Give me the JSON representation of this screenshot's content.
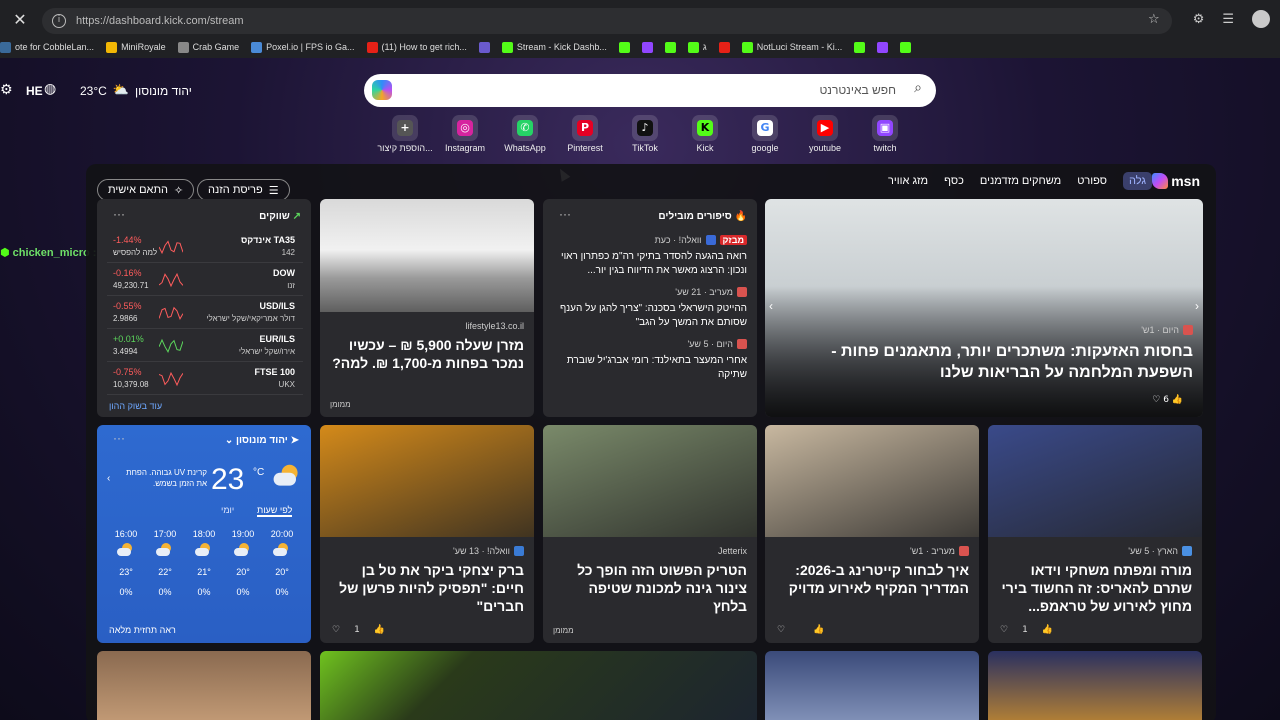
{
  "browser": {
    "url": "https://dashboard.kick.com/stream",
    "bookmarks": [
      {
        "label": "ote for CobbleLan...",
        "color": "#3a6a9a"
      },
      {
        "label": "MiniRoyale",
        "color": "#f2b705"
      },
      {
        "label": "Crab Game",
        "color": "#888"
      },
      {
        "label": "Poxel.io | FPS io Ga...",
        "color": "#4a8ad6"
      },
      {
        "label": "(11) How to get rich...",
        "color": "#e62117"
      },
      {
        "label": "",
        "color": "#6a5acd"
      },
      {
        "label": "Stream - Kick Dashb...",
        "color": "#53fc18"
      },
      {
        "label": "",
        "color": "#53fc18"
      },
      {
        "label": "",
        "color": "#9146ff"
      },
      {
        "label": "",
        "color": "#53fc18"
      },
      {
        "label": "ג",
        "color": "#53fc18"
      },
      {
        "label": "",
        "color": "#e62117"
      },
      {
        "label": "NotLuci Stream - Ki...",
        "color": "#53fc18"
      },
      {
        "label": "",
        "color": "#53fc18"
      },
      {
        "label": "",
        "color": "#9146ff"
      },
      {
        "label": "",
        "color": "#53fc18"
      }
    ]
  },
  "toolbar": {
    "lang": "HE",
    "temp": "23°C",
    "city": "יהוד מונוסון"
  },
  "search": {
    "placeholder": "חפש באינטרנט"
  },
  "quick_links": [
    {
      "label": "הוספת קיצור...",
      "icon": "+",
      "color": "#555"
    },
    {
      "label": "Instagram",
      "icon": "◎",
      "color": "#d6249f"
    },
    {
      "label": "WhatsApp",
      "icon": "✆",
      "color": "#25d366"
    },
    {
      "label": "Pinterest",
      "icon": "P",
      "color": "#e60023"
    },
    {
      "label": "TikTok",
      "icon": "♪",
      "color": "#111"
    },
    {
      "label": "Kick",
      "icon": "K",
      "color": "#53fc18"
    },
    {
      "label": "google",
      "icon": "G",
      "color": "#fff"
    },
    {
      "label": "youtube",
      "icon": "▶",
      "color": "#ff0000"
    },
    {
      "label": "twitch",
      "icon": "▣",
      "color": "#9146ff"
    }
  ],
  "feed_nav": {
    "brand": "msn",
    "items": [
      "גלה",
      "ספורט",
      "משחקים מזדמנים",
      "כסף",
      "מזג אוויר"
    ],
    "active": "גלה",
    "personalize": "התאם אישית",
    "layout": "פריסת הזנה"
  },
  "hero": {
    "source": "היום · 1ש'",
    "title": "בחסות האזעקות: משתכרים יותר, מתאמנים פחות - השפעת המלחמה על הבריאות שלנו",
    "likes": "6"
  },
  "top_stories": {
    "header": "סיפורים מובילים",
    "items": [
      {
        "source": "וואלה! · כעת",
        "badge": "מבזק",
        "text": "רואה בהגעה להסדר בתיקי רה\"מ כפתרון ראוי ונכון: הרצוג מאשר את הדיווח בגין יור..."
      },
      {
        "source": "מעריב · 21 שע'",
        "text": "ההייטק הישראלי בסכנה: \"צריך להגן על הענף שסותם את המשך על הגב\""
      },
      {
        "source": "היום · 5 שע'",
        "text": "אחרי המעצר בתאילנד: רומי אברג'יל שוברת שתיקה"
      }
    ]
  },
  "mattress": {
    "source": "lifestyle13.co.il",
    "title": "מזרן שעלה 5,900 ₪ – עכשיו נמכר בפחות מ-1,700 ₪. למה?",
    "sponsored": "ממומן"
  },
  "markets": {
    "header": "שווקים",
    "rows": [
      {
        "name": "אינדקס TA35",
        "sub": "142",
        "change": "-1.44%",
        "value": "למה להפסיש",
        "color": "#ff5c5c"
      },
      {
        "name": "DOW",
        "sub": "זנו",
        "change": "-0.16%",
        "value": "49,230.71",
        "color": "#ff5c5c"
      },
      {
        "name": "USD/ILS",
        "sub": "דולר אמריקאי/שקל ישראלי",
        "change": "-0.55%",
        "value": "2.9866",
        "color": "#ff5c5c"
      },
      {
        "name": "EUR/ILS",
        "sub": "אירו/שקל ישראלי",
        "change": "+0.01%",
        "value": "3.4994",
        "color": "#5cd65c"
      },
      {
        "name": "FTSE 100",
        "sub": "UKX",
        "change": "-0.75%",
        "value": "10,379.08",
        "color": "#ff5c5c"
      }
    ],
    "more": "עוד בשוק ההון"
  },
  "weather": {
    "city": "יהוד מונוסון",
    "temp": "23",
    "unit": "°C",
    "desc": "קרינת UV גבוהה. הפחת את הזמן בשמש.",
    "tabs": [
      "לפי שעות",
      "יומי"
    ],
    "hours": [
      {
        "time": "20:00",
        "temp": "20°",
        "rain": "0%"
      },
      {
        "time": "19:00",
        "temp": "20°",
        "rain": "0%"
      },
      {
        "time": "18:00",
        "temp": "21°",
        "rain": "0%"
      },
      {
        "time": "17:00",
        "temp": "22°",
        "rain": "0%"
      },
      {
        "time": "16:00",
        "temp": "23°",
        "rain": "0%"
      }
    ],
    "more": "ראה תחזית מלאה"
  },
  "row2": [
    {
      "source": "הארץ · 5 שע'",
      "title": "מורה ומפתח משחקי וידאו שתרם להאריס: זה החשוד בירי מחוץ לאירוע של טראמפ...",
      "likes": "1",
      "color": "#3a4a8a",
      "src_color": "#4a90e2"
    },
    {
      "source": "מעריב · 1ש'",
      "title": "איך לבחור קייטרינג ב-2026: המדריך המקיף לאירוע מדויק",
      "likes": "",
      "color": "#c8b8a0",
      "src_color": "#d9534f"
    },
    {
      "source": "Jetterix",
      "title": "הטריק הפשוט הזה הופך כל צינור גינה למכונת שטיפה בלחץ",
      "likes": "",
      "color": "#7a8a6a",
      "src_color": "",
      "sponsored": "ממומן"
    },
    {
      "source": "וואלה! · 13 שע'",
      "title": "ברק יצחקי ביקר את טל בן חיים: \"תפסיק להיות פרשן של חברים\"",
      "likes": "1",
      "color": "#d48a1a",
      "src_color": "#3a7bd5"
    }
  ],
  "chat_overlay": "chicken_micro : למה להפסיש"
}
